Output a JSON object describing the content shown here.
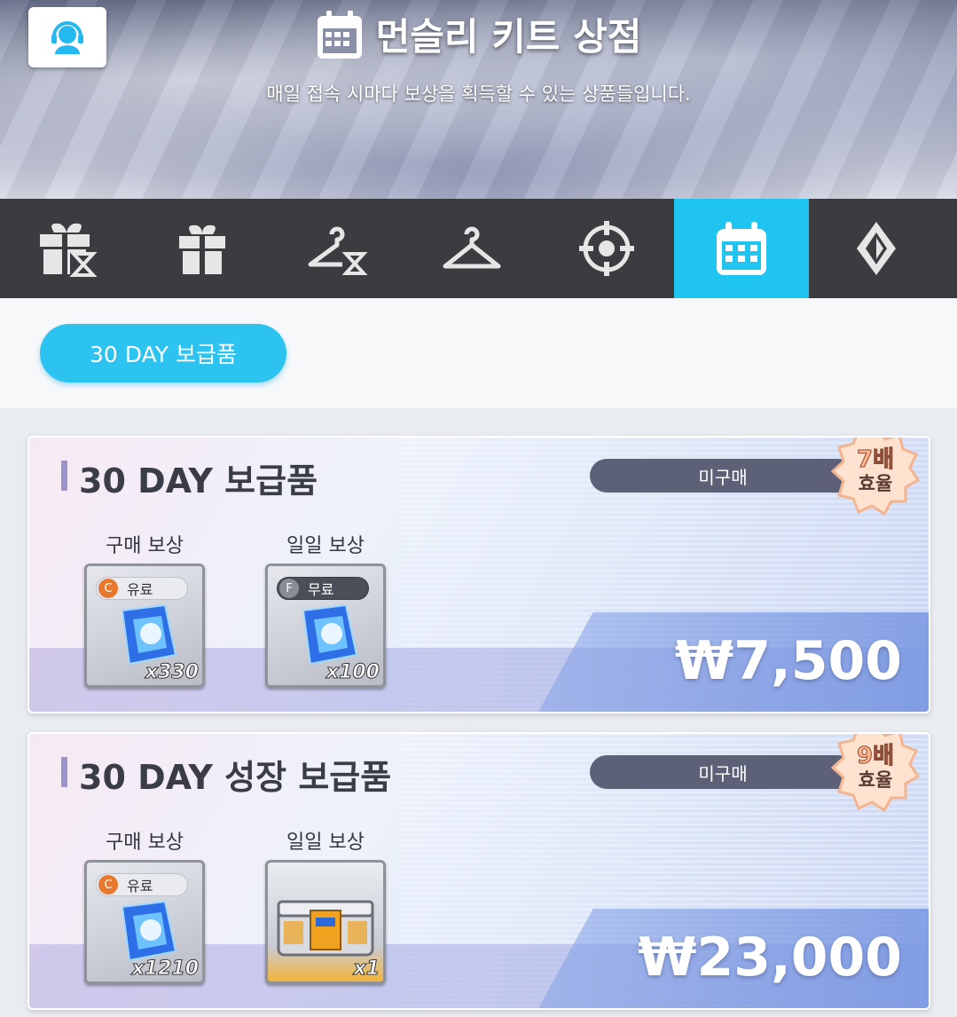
{
  "header": {
    "title": "먼슬리 키트 상점",
    "subtitle": "매일 접속 시마다 보상을 획득할 수 있는 상품들입니다."
  },
  "tabs": [
    {
      "icon": "gift-timer-icon",
      "active": false
    },
    {
      "icon": "gift-icon",
      "active": false
    },
    {
      "icon": "hanger-timer-icon",
      "active": false
    },
    {
      "icon": "hanger-icon",
      "active": false
    },
    {
      "icon": "target-icon",
      "active": false
    },
    {
      "icon": "calendar-icon",
      "active": true
    },
    {
      "icon": "diamond-emblem-icon",
      "active": false
    }
  ],
  "subtab": {
    "label": "30 DAY 보급품"
  },
  "products": [
    {
      "title": "30 DAY 보급품",
      "status": "미구매",
      "badge_multiplier": "7배",
      "badge_label": "효율",
      "purchase_reward_label": "구매 보상",
      "daily_reward_label": "일일 보상",
      "purchase_item": {
        "tag": "유료",
        "coin": "C",
        "quantity": "x330",
        "icon": "blue-crystal-icon"
      },
      "daily_item": {
        "tag": "무료",
        "coin": "F",
        "quantity": "x100",
        "icon": "blue-crystal-icon"
      },
      "price": "₩7,500"
    },
    {
      "title": "30 DAY 성장 보급품",
      "status": "미구매",
      "badge_multiplier": "9배",
      "badge_label": "효율",
      "purchase_reward_label": "구매 보상",
      "daily_reward_label": "일일 보상",
      "purchase_item": {
        "tag": "유료",
        "coin": "C",
        "quantity": "x1210",
        "icon": "blue-crystal-icon"
      },
      "daily_item": {
        "quantity": "x1",
        "icon": "supply-chest-icon"
      },
      "price": "₩23,000"
    }
  ],
  "colors": {
    "accent": "#1fc4f0",
    "tabbar": "#3a3c40",
    "status_pill": "#5c6178",
    "paid_coin": "#e8782e",
    "free_coin": "#8a8d96"
  }
}
